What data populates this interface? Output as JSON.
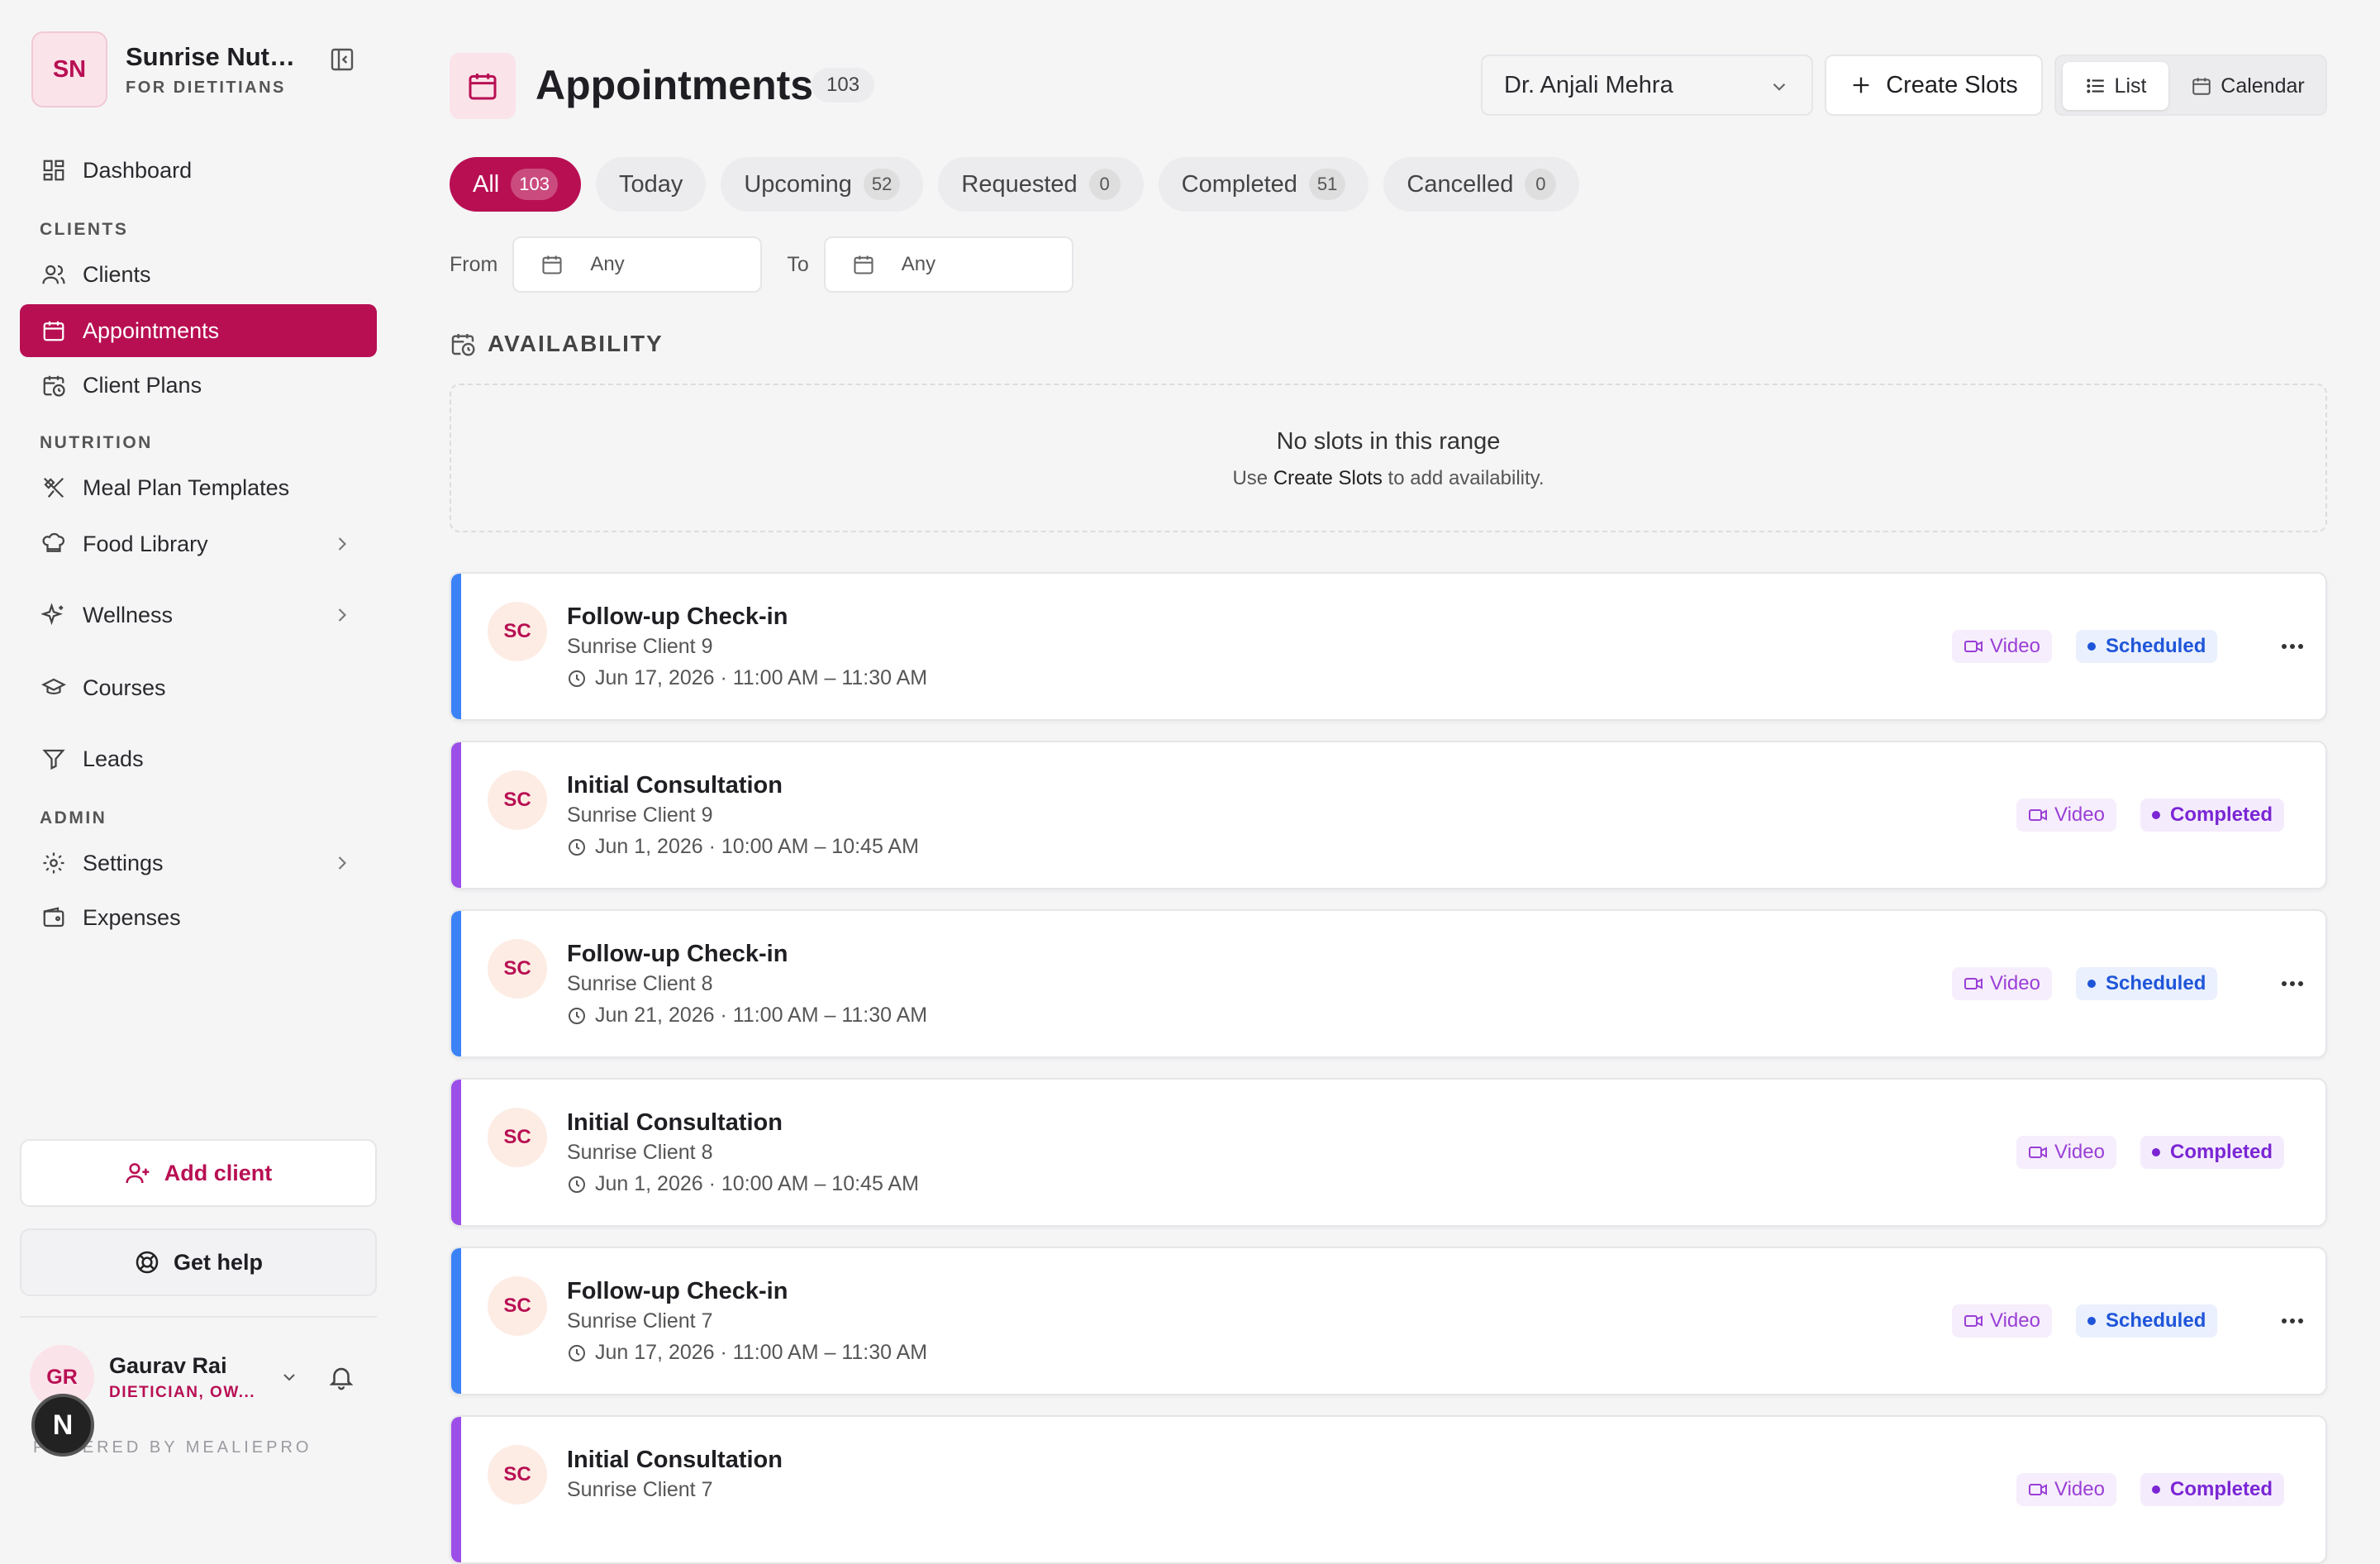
{
  "brand": {
    "initials": "SN",
    "name": "Sunrise Nutrition",
    "subtitle": "FOR DIETITIANS"
  },
  "nav": {
    "dashboard": "Dashboard",
    "clients_section": "CLIENTS",
    "clients": "Clients",
    "appointments": "Appointments",
    "client_plans": "Client Plans",
    "nutrition_section": "NUTRITION",
    "meal_plan_templates": "Meal Plan Templates",
    "food_library": "Food Library",
    "wellness": "Wellness",
    "courses": "Courses",
    "leads": "Leads",
    "admin_section": "ADMIN",
    "settings": "Settings",
    "expenses": "Expenses"
  },
  "sidebar_actions": {
    "add_client": "Add client",
    "get_help": "Get help"
  },
  "user": {
    "initials": "GR",
    "name": "Gaurav Rai",
    "role": "DIETICIAN, OW..."
  },
  "footer": {
    "powered_by": "POWERED BY MEALIEPRO",
    "n_badge": "N"
  },
  "page": {
    "title": "Appointments",
    "count": "103"
  },
  "toolbar": {
    "doctor": "Dr. Anjali Mehra",
    "create_slots": "Create Slots",
    "view_list": "List",
    "view_calendar": "Calendar"
  },
  "tabs": [
    {
      "label": "All",
      "count": "103"
    },
    {
      "label": "Today",
      "count": ""
    },
    {
      "label": "Upcoming",
      "count": "52"
    },
    {
      "label": "Requested",
      "count": "0"
    },
    {
      "label": "Completed",
      "count": "51"
    },
    {
      "label": "Cancelled",
      "count": "0"
    }
  ],
  "filters": {
    "from_label": "From",
    "from_value": "Any",
    "to_label": "To",
    "to_value": "Any"
  },
  "availability": {
    "heading": "AVAILABILITY",
    "empty_title": "No slots in this range",
    "empty_sub_pre": "Use ",
    "empty_sub_link": "Create Slots",
    "empty_sub_post": " to add availability."
  },
  "colors": {
    "accent": "#b80f53",
    "scheduled_bar": "#3b82f6",
    "completed_bar": "#9b4ee8"
  },
  "appointments": [
    {
      "initials": "SC",
      "title": "Follow-up Check-in",
      "client": "Sunrise Client 9",
      "datetime": "Jun 17, 2026 · 11:00 AM – 11:30 AM",
      "mode": "Video",
      "status": "Scheduled"
    },
    {
      "initials": "SC",
      "title": "Initial Consultation",
      "client": "Sunrise Client 9",
      "datetime": "Jun 1, 2026 · 10:00 AM – 10:45 AM",
      "mode": "Video",
      "status": "Completed"
    },
    {
      "initials": "SC",
      "title": "Follow-up Check-in",
      "client": "Sunrise Client 8",
      "datetime": "Jun 21, 2026 · 11:00 AM – 11:30 AM",
      "mode": "Video",
      "status": "Scheduled"
    },
    {
      "initials": "SC",
      "title": "Initial Consultation",
      "client": "Sunrise Client 8",
      "datetime": "Jun 1, 2026 · 10:00 AM – 10:45 AM",
      "mode": "Video",
      "status": "Completed"
    },
    {
      "initials": "SC",
      "title": "Follow-up Check-in",
      "client": "Sunrise Client 7",
      "datetime": "Jun 17, 2026 · 11:00 AM – 11:30 AM",
      "mode": "Video",
      "status": "Scheduled"
    },
    {
      "initials": "SC",
      "title": "Initial Consultation",
      "client": "Sunrise Client 7",
      "datetime": "",
      "mode": "Video",
      "status": "Completed"
    }
  ]
}
